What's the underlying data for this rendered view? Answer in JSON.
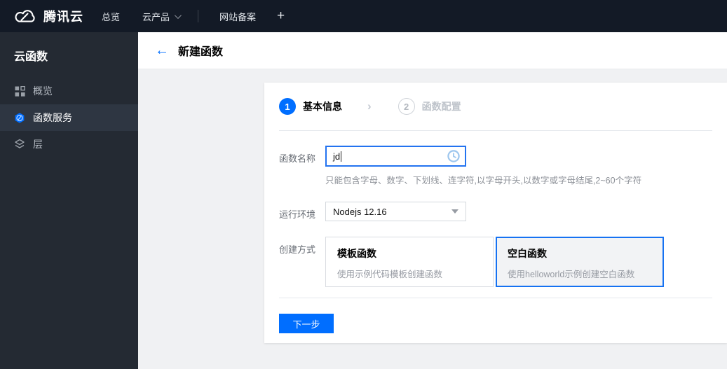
{
  "colors": {
    "accent": "#006eff",
    "topbar_bg": "#131a26",
    "sidebar_bg": "#242a33",
    "sidebar_selected_bg": "#2e3642",
    "content_bg": "#f0f1f3",
    "selected_card_bg": "#f2f3f5"
  },
  "topbar": {
    "brand": "腾讯云",
    "items": [
      {
        "label": "总览"
      },
      {
        "label": "云产品"
      },
      {
        "label": "网站备案"
      }
    ],
    "plus_label": "+"
  },
  "sidebar": {
    "title": "云函数",
    "items": [
      {
        "label": "概览",
        "icon": "overview-grid-icon",
        "selected": false
      },
      {
        "label": "函数服务",
        "icon": "scf-hexagon-icon",
        "selected": true
      },
      {
        "label": "层",
        "icon": "layers-icon",
        "selected": false
      }
    ]
  },
  "header": {
    "back_icon": "←",
    "title": "新建函数"
  },
  "wizard": {
    "steps": [
      {
        "number": "1",
        "label": "基本信息",
        "active": true
      },
      {
        "number": "2",
        "label": "函数配置",
        "active": false
      }
    ],
    "step_separator": "›",
    "form": {
      "name": {
        "label": "函数名称",
        "value": "jd",
        "helper": "只能包含字母、数字、下划线、连字符,以字母开头,以数字或字母结尾,2~60个字符",
        "status_icon": "clock-pending-icon"
      },
      "runtime": {
        "label": "运行环境",
        "value": "Nodejs 12.16"
      },
      "method": {
        "label": "创建方式",
        "options": [
          {
            "title": "模板函数",
            "desc": "使用示例代码模板创建函数",
            "selected": false
          },
          {
            "title": "空白函数",
            "desc": "使用helloworld示例创建空白函数",
            "selected": true
          }
        ]
      }
    },
    "next_button": "下一步"
  }
}
